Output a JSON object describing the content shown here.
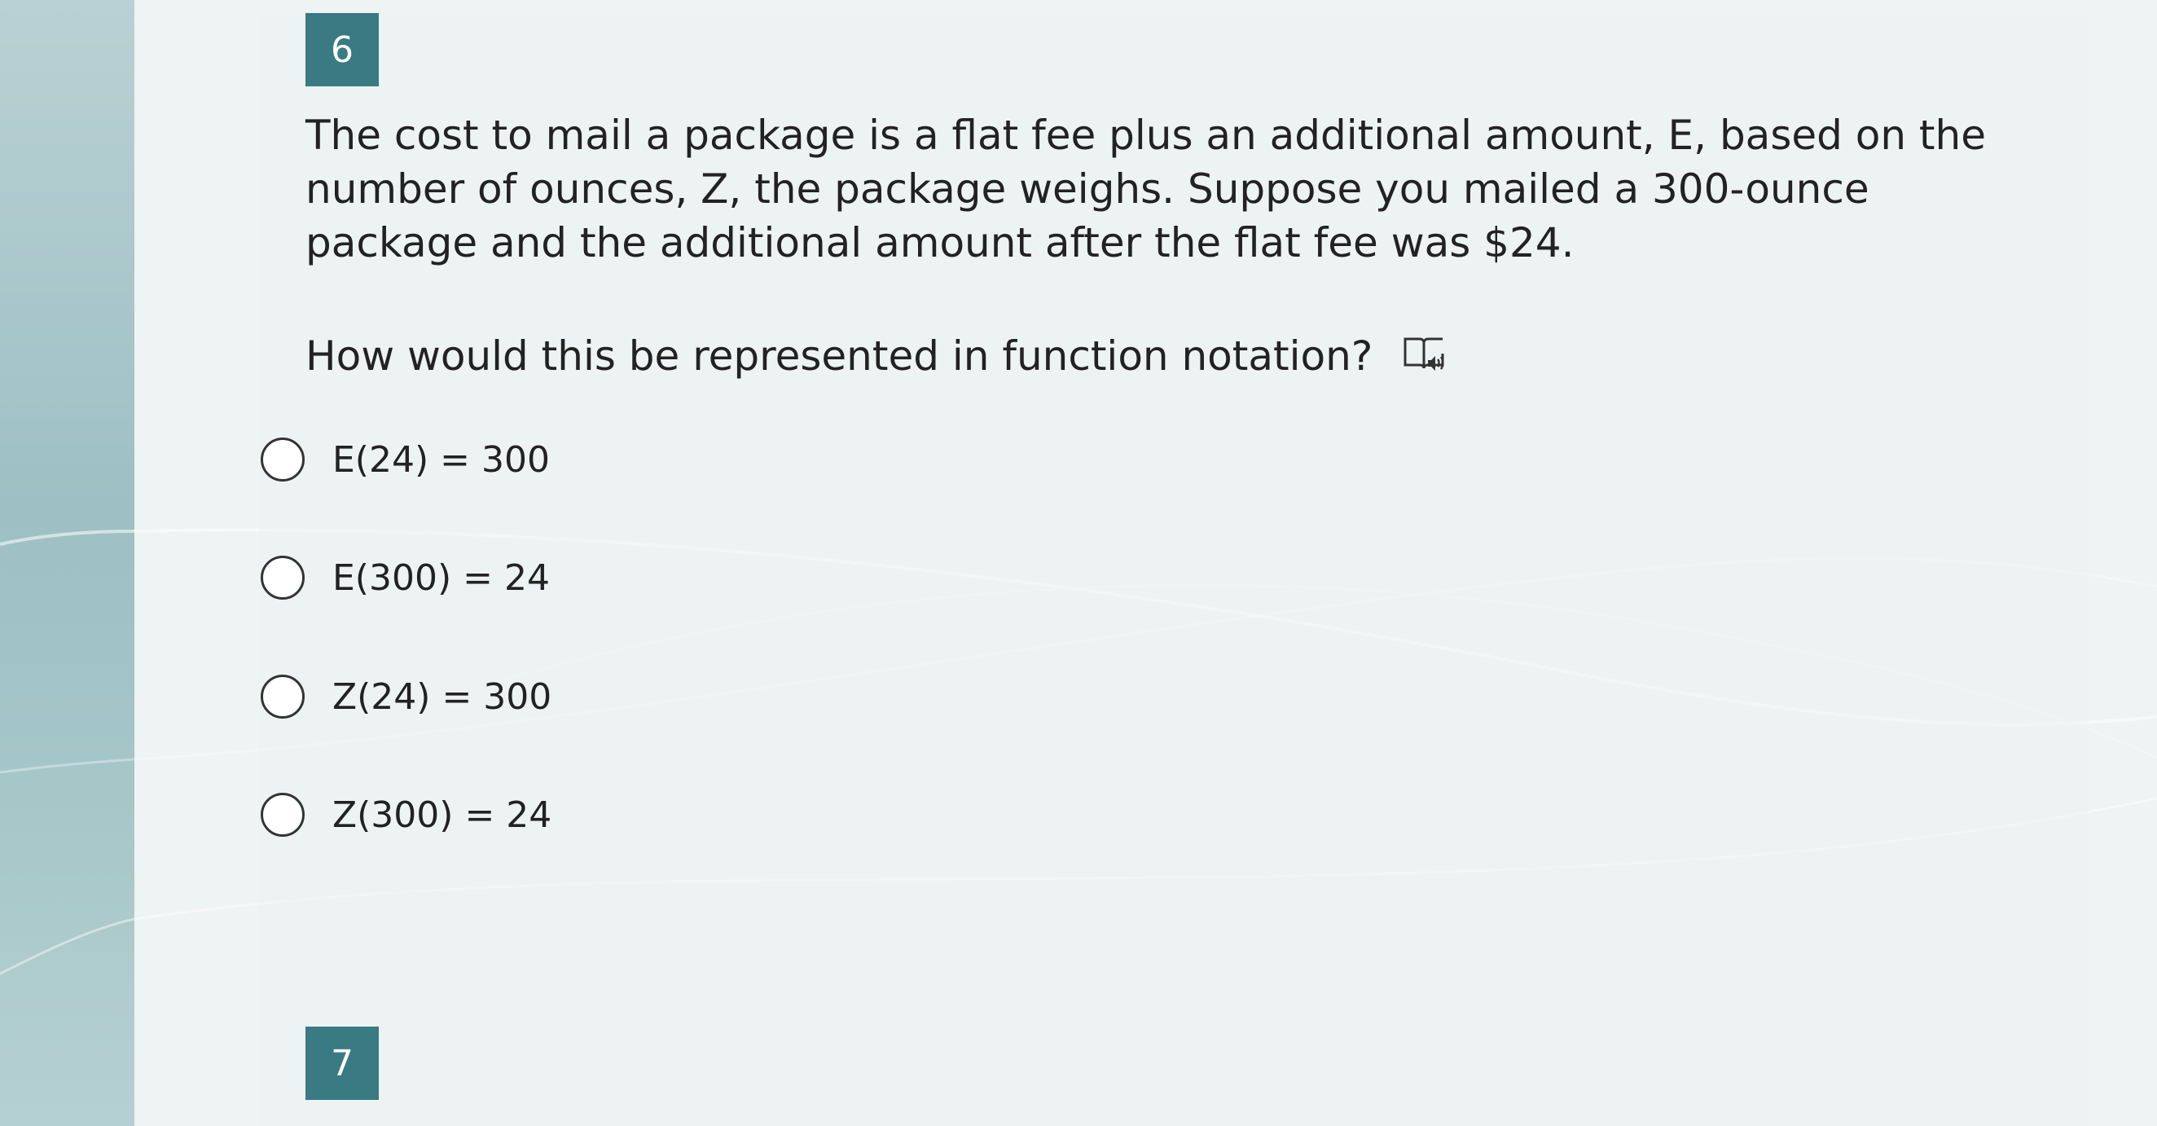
{
  "question_6": {
    "number": "6",
    "stem": "The cost to mail a package is a flat fee plus an additional amount, E, based on the number of ounces, Z, the package weighs. Suppose you mailed a 300-ounce package and the additional amount after the flat fee was $24.",
    "prompt": "How would this be represented in function notation?",
    "audio_icon": "read-aloud-icon",
    "choices": [
      {
        "label": "E(24) = 300",
        "selected": false
      },
      {
        "label": "E(300) = 24",
        "selected": false
      },
      {
        "label": "Z(24) = 300",
        "selected": false
      },
      {
        "label": "Z(300) = 24",
        "selected": false
      }
    ]
  },
  "question_7": {
    "number": "7"
  },
  "colors": {
    "badge": "#3a7a82",
    "text": "#222222",
    "background": "#eef3f4",
    "left_band": "#a6c6c8"
  }
}
